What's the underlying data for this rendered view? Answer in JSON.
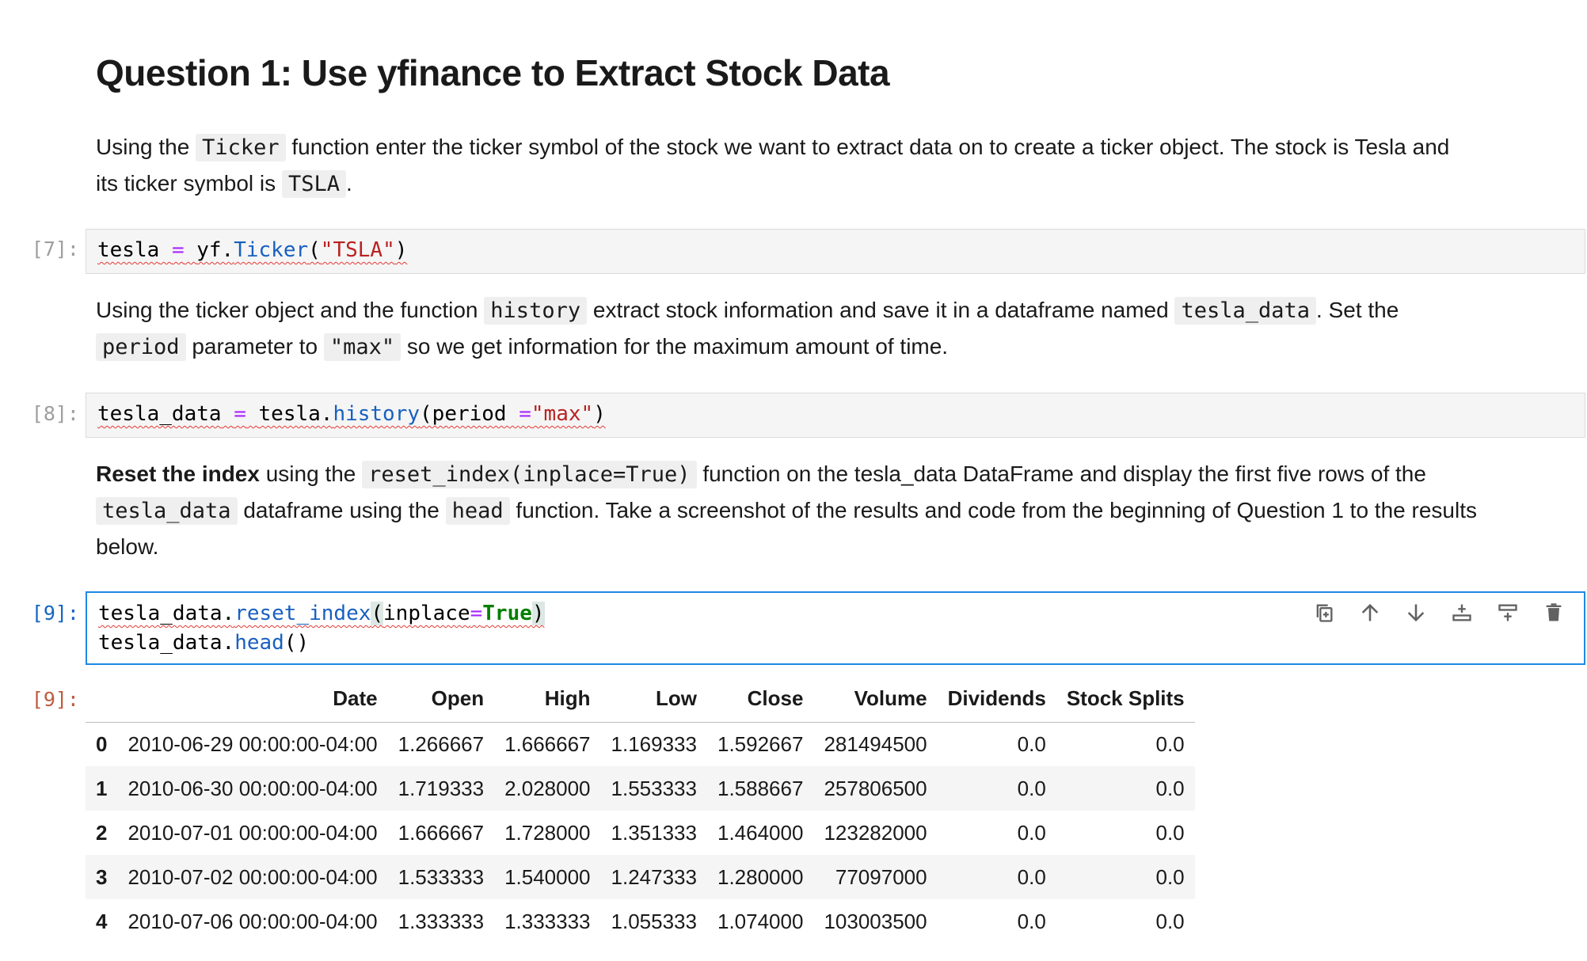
{
  "heading": "Question 1: Use yfinance to Extract Stock Data",
  "md1": {
    "a": "Using the ",
    "code1": "Ticker",
    "b": " function enter the ticker symbol of the stock we want to extract data on to create a ticker object. The stock is Tesla and",
    "c": "its ticker symbol is ",
    "code2": "TSLA",
    "d": "."
  },
  "cell7": {
    "prompt": "[7]:",
    "v1": "tesla",
    "eq": "=",
    "v2": "yf.",
    "fn": "Ticker",
    "p1": "(",
    "arg": "\"TSLA\"",
    "p2": ")"
  },
  "md2": {
    "a": "Using the ticker object and the function ",
    "code1": "history",
    "b": " extract stock information and save it in a dataframe named ",
    "code2": "tesla_data",
    "c": ". Set the",
    "code3": "period",
    "d": " parameter to ",
    "code4": "\"max\"",
    "e": " so we get information for the maximum amount of time."
  },
  "cell8": {
    "prompt": "[8]:",
    "v1": "tesla_data",
    "eq": "=",
    "v2": "tesla.",
    "fn": "history",
    "p1": "(period ",
    "eq2": "=",
    "arg": "\"max\"",
    "p2": ")"
  },
  "md3": {
    "bold": "Reset the index",
    "a": " using the ",
    "code1": "reset_index(inplace=True)",
    "b": " function on the tesla_data DataFrame and display the first five rows of the",
    "code2": "tesla_data",
    "c": " dataframe using the ",
    "code3": "head",
    "d": " function. Take a screenshot of the results and code from the beginning of Question 1 to the results",
    "e": "below."
  },
  "cell9": {
    "prompt": "[9]:",
    "l1a": "tesla_data.",
    "l1fn": "reset_index",
    "l1p": "(",
    "l1arg": "inplace",
    "l1eq": "=",
    "l1kw": "True",
    "l1p2": ")",
    "l2a": "tesla_data.",
    "l2fn": "head",
    "l2p": "()"
  },
  "toolbar": {
    "icons": [
      "duplicate-icon",
      "move-up-icon",
      "move-down-icon",
      "insert-below-icon",
      "insert-above-icon",
      "delete-icon"
    ]
  },
  "output": {
    "prompt": "[9]:",
    "columns": [
      "",
      "Date",
      "Open",
      "High",
      "Low",
      "Close",
      "Volume",
      "Dividends",
      "Stock Splits"
    ],
    "rows": [
      [
        "0",
        "2010-06-29 00:00:00-04:00",
        "1.266667",
        "1.666667",
        "1.169333",
        "1.592667",
        "281494500",
        "0.0",
        "0.0"
      ],
      [
        "1",
        "2010-06-30 00:00:00-04:00",
        "1.719333",
        "2.028000",
        "1.553333",
        "1.588667",
        "257806500",
        "0.0",
        "0.0"
      ],
      [
        "2",
        "2010-07-01 00:00:00-04:00",
        "1.666667",
        "1.728000",
        "1.351333",
        "1.464000",
        "123282000",
        "0.0",
        "0.0"
      ],
      [
        "3",
        "2010-07-02 00:00:00-04:00",
        "1.533333",
        "1.540000",
        "1.247333",
        "1.280000",
        "77097000",
        "0.0",
        "0.0"
      ],
      [
        "4",
        "2010-07-06 00:00:00-04:00",
        "1.333333",
        "1.333333",
        "1.055333",
        "1.074000",
        "103003500",
        "0.0",
        "0.0"
      ]
    ]
  }
}
